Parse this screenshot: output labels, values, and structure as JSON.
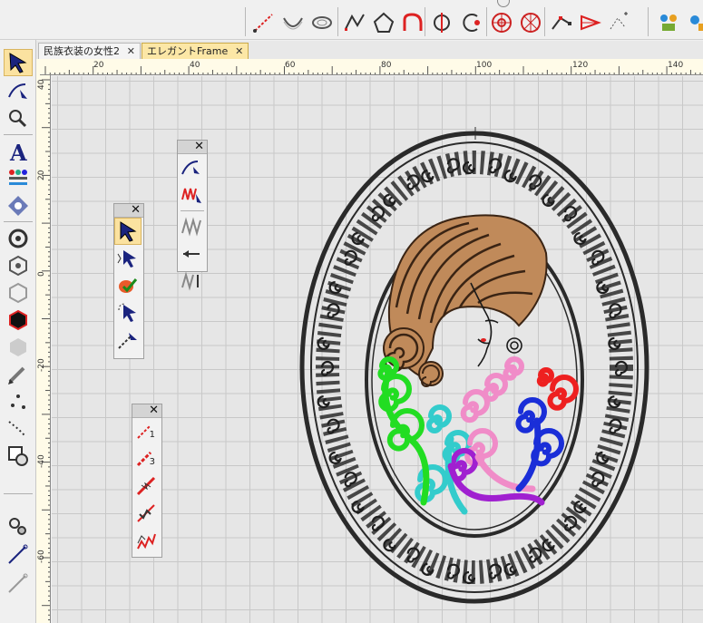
{
  "tabs": [
    {
      "label": "民族衣装の女性2",
      "close": "✕"
    },
    {
      "label": "エレガントFrame",
      "close": "✕"
    }
  ],
  "ruler_h": [
    "20",
    "40",
    "60",
    "80",
    "100",
    "120",
    "140"
  ],
  "ruler_v": [
    "40",
    "20",
    "0",
    "-20",
    "-40",
    "-60"
  ],
  "palettes": {
    "close": "✕",
    "stitch_numbers": [
      "1",
      "3"
    ]
  },
  "colors": {
    "accent": "#fbe2a0",
    "tab_active": "#fce7a6",
    "frame": "#2a2a2a",
    "hair": "#c08050",
    "green": "#22dd22",
    "cyan": "#33cccc",
    "pink": "#f08cc8",
    "blue": "#1a2ed8",
    "red": "#ee2020",
    "purple": "#a020d0"
  }
}
